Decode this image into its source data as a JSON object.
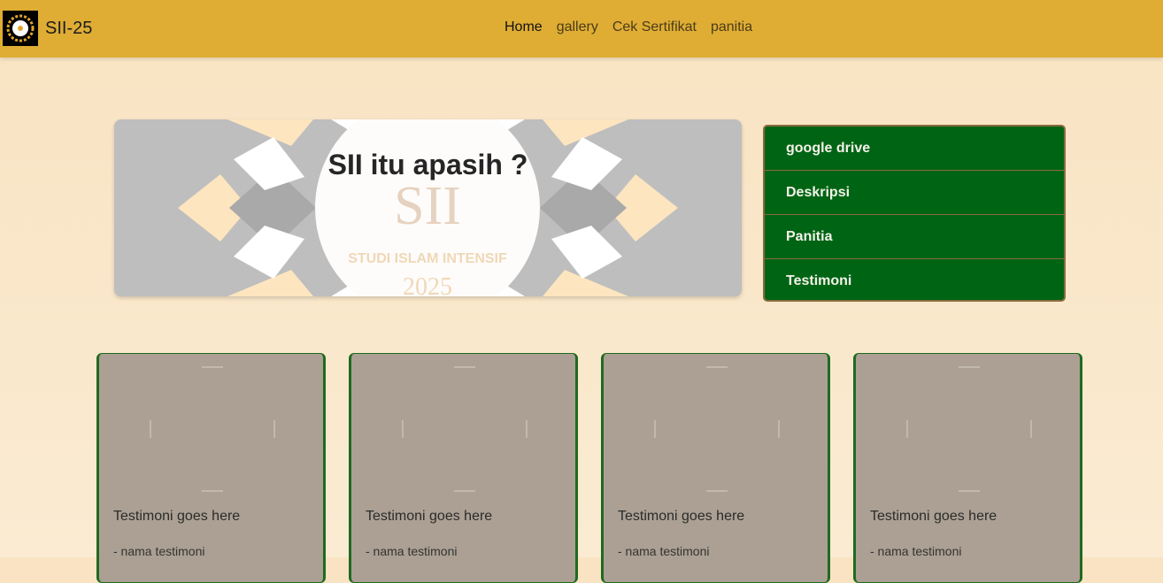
{
  "nav": {
    "brand": "SII-25",
    "links": [
      "Home",
      "gallery",
      "Cek Sertifikat",
      "panitia"
    ]
  },
  "hero": {
    "title": "SII itu apasih ?",
    "banner_line1": "SII",
    "banner_line2": "STUDI ISLAM INTENSIF",
    "banner_line3": "2025"
  },
  "menu": {
    "items": [
      "google drive",
      "Deskripsi",
      "Panitia",
      "Testimoni"
    ]
  },
  "testimonials": [
    {
      "text": "Testimoni goes here",
      "name": "- nama testimoni"
    },
    {
      "text": "Testimoni goes here",
      "name": "- nama testimoni"
    },
    {
      "text": "Testimoni goes here",
      "name": "- nama testimoni"
    },
    {
      "text": "Testimoni goes here",
      "name": "- nama testimoni"
    }
  ],
  "colors": {
    "navbar": "#dfad34",
    "menu_green": "#006415",
    "card": "#aba093",
    "background": "#f9e3c2"
  }
}
